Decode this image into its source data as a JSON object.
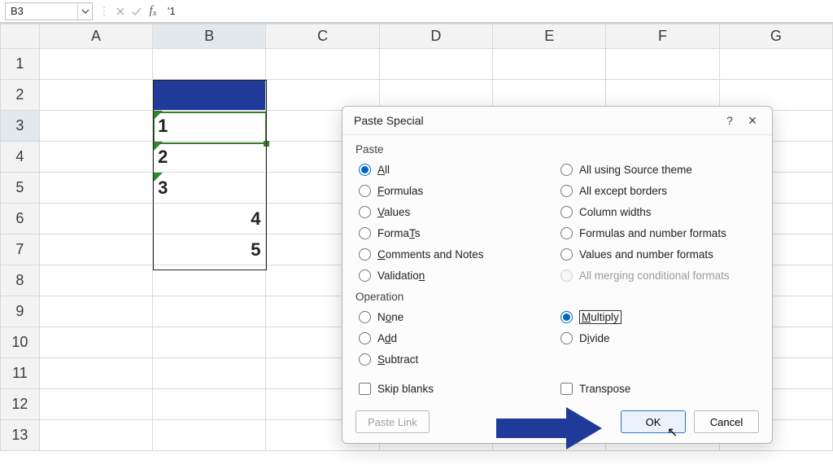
{
  "formula_bar": {
    "name_box": "B3",
    "formula": "'1"
  },
  "grid": {
    "columns": [
      "A",
      "B",
      "C",
      "D",
      "E",
      "F",
      "G"
    ],
    "row_headers": [
      "1",
      "2",
      "3",
      "4",
      "5",
      "6",
      "7",
      "8",
      "9",
      "10",
      "11",
      "12",
      "13"
    ],
    "cells": {
      "B3": {
        "value": "1",
        "align": "left",
        "text_as_number": true
      },
      "B4": {
        "value": "2",
        "align": "left",
        "text_as_number": true
      },
      "B5": {
        "value": "3",
        "align": "left",
        "text_as_number": true
      },
      "B6": {
        "value": "4",
        "align": "right",
        "text_as_number": false
      },
      "B7": {
        "value": "5",
        "align": "right",
        "text_as_number": false
      }
    },
    "selected_cell": "B3",
    "blue_cell": "B2"
  },
  "dialog": {
    "title": "Paste Special",
    "section_paste": "Paste",
    "paste_options_left": [
      {
        "key": "all",
        "label": "All",
        "underline": "A",
        "checked": true
      },
      {
        "key": "formulas",
        "label": "Formulas",
        "underline": "F"
      },
      {
        "key": "values",
        "label": "Values",
        "underline": "V"
      },
      {
        "key": "formats",
        "label": "Formats",
        "underline": "T"
      },
      {
        "key": "comments",
        "label": "Comments and Notes",
        "underline": "C"
      },
      {
        "key": "validation",
        "label": "Validation",
        "underline": "n"
      }
    ],
    "paste_options_right": [
      {
        "key": "all_theme",
        "label": "All using Source theme",
        "underline": "H"
      },
      {
        "key": "except_borders",
        "label": "All except borders",
        "underline": "x"
      },
      {
        "key": "col_widths",
        "label": "Column widths",
        "underline": "w"
      },
      {
        "key": "formulas_num",
        "label": "Formulas and number formats",
        "underline": "R"
      },
      {
        "key": "values_num",
        "label": "Values and number formats",
        "underline": "u"
      },
      {
        "key": "merge_cond",
        "label": "All merging conditional formats",
        "disabled": true
      }
    ],
    "section_operation": "Operation",
    "op_left": [
      {
        "key": "none",
        "label": "None",
        "underline": "o"
      },
      {
        "key": "add",
        "label": "Add",
        "underline": "d"
      },
      {
        "key": "subtract",
        "label": "Subtract",
        "underline": "S"
      }
    ],
    "op_right": [
      {
        "key": "multiply",
        "label": "Multiply",
        "underline": "M",
        "checked": true,
        "focus": true
      },
      {
        "key": "divide",
        "label": "Divide",
        "underline": "i"
      }
    ],
    "skip_blanks": "Skip blanks",
    "transpose": "Transpose",
    "paste_link": "Paste Link",
    "ok": "OK",
    "cancel": "Cancel",
    "help": "?",
    "close": "×"
  }
}
